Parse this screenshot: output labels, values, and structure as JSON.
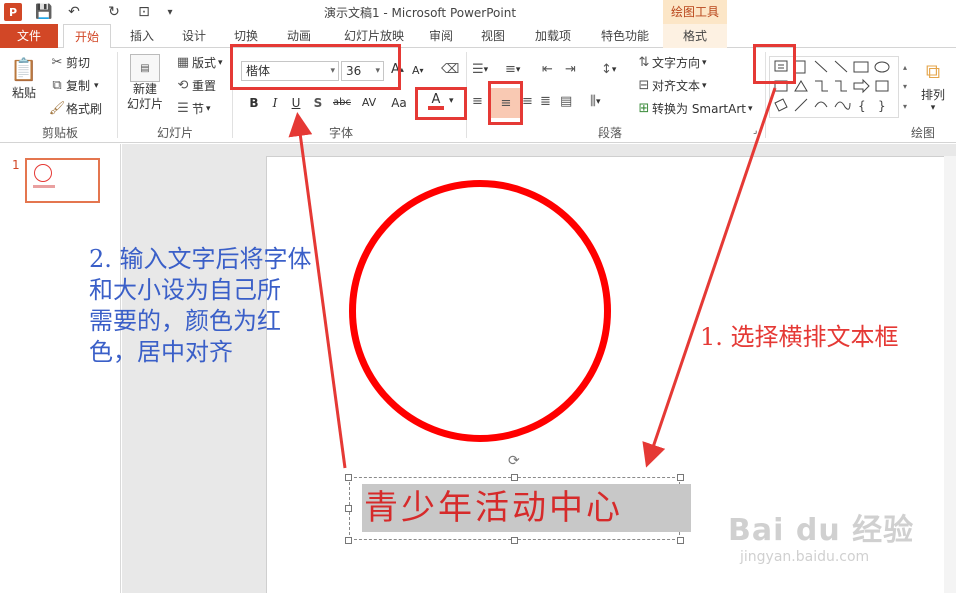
{
  "window": {
    "title": "演示文稿1 - Microsoft PowerPoint",
    "context_tool": "绘图工具",
    "app_logo": "P"
  },
  "quick_access": {
    "save": "💾",
    "undo": "↶",
    "redo": "↻",
    "present": "⊡",
    "customize": "▾"
  },
  "tabs": {
    "file": "文件",
    "home": "开始",
    "insert": "插入",
    "design": "设计",
    "transitions": "切换",
    "animations": "动画",
    "slideshow": "幻灯片放映",
    "review": "审阅",
    "view": "视图",
    "addins": "加载项",
    "special": "特色功能",
    "format": "格式"
  },
  "ribbon": {
    "clipboard": {
      "label": "剪贴板",
      "paste": "粘贴",
      "cut": "剪切",
      "copy": "复制",
      "format_painter": "格式刷"
    },
    "slides": {
      "label": "幻灯片",
      "new_slide_line1": "新建",
      "new_slide_line2": "幻灯片",
      "layout": "版式",
      "reset": "重置",
      "section": "节"
    },
    "font": {
      "label": "字体",
      "font_name": "楷体",
      "font_size": "36",
      "bold": "B",
      "italic": "I",
      "underline": "U",
      "shadow": "S",
      "strike": "abc",
      "spacing": "AV",
      "case": "Aa",
      "color_letter": "A",
      "font_color": "#e53935",
      "grow": "A",
      "shrink": "A"
    },
    "paragraph": {
      "label": "段落",
      "text_direction": "文字方向",
      "align_text": "对齐文本",
      "smartart": "转换为 SmartArt"
    },
    "drawing": {
      "label": "绘图",
      "arrange": "排列"
    }
  },
  "slide_panel": {
    "slide_number": "1"
  },
  "slide": {
    "textbox_text": "青少年活动中心",
    "circle_color": "#ff0000",
    "text_color": "#d62a2a"
  },
  "annotations": {
    "step2_line1": "2. 输入文字后将字体",
    "step2_line2": "和大小设为自己所",
    "step2_line3": "需要的，颜色为红",
    "step2_line4": "色，居中对齐",
    "step1": "1. 选择横排文本框",
    "blue": "#3a5fc8",
    "red": "#e53935"
  },
  "watermark": {
    "logo": "Bai du 经验",
    "url": "jingyan.baidu.com"
  }
}
